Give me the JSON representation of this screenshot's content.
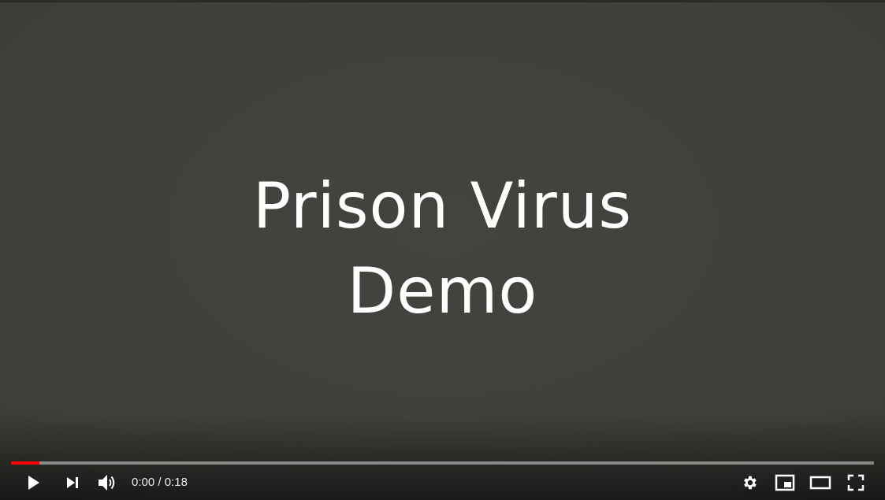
{
  "video": {
    "title_line_1": "Prison Virus",
    "title_line_2": "Demo"
  },
  "progress": {
    "played_fraction": 0.033,
    "loaded_fraction": 0.033,
    "played_color": "#ff0000"
  },
  "time": {
    "current": "0:00",
    "separator": "/",
    "duration": "0:18"
  },
  "icons": {
    "play": "play-icon",
    "next": "next-icon",
    "volume": "volume-icon",
    "settings": "gear-icon",
    "miniplayer": "miniplayer-icon",
    "theater": "theater-mode-icon",
    "fullscreen": "fullscreen-icon"
  }
}
